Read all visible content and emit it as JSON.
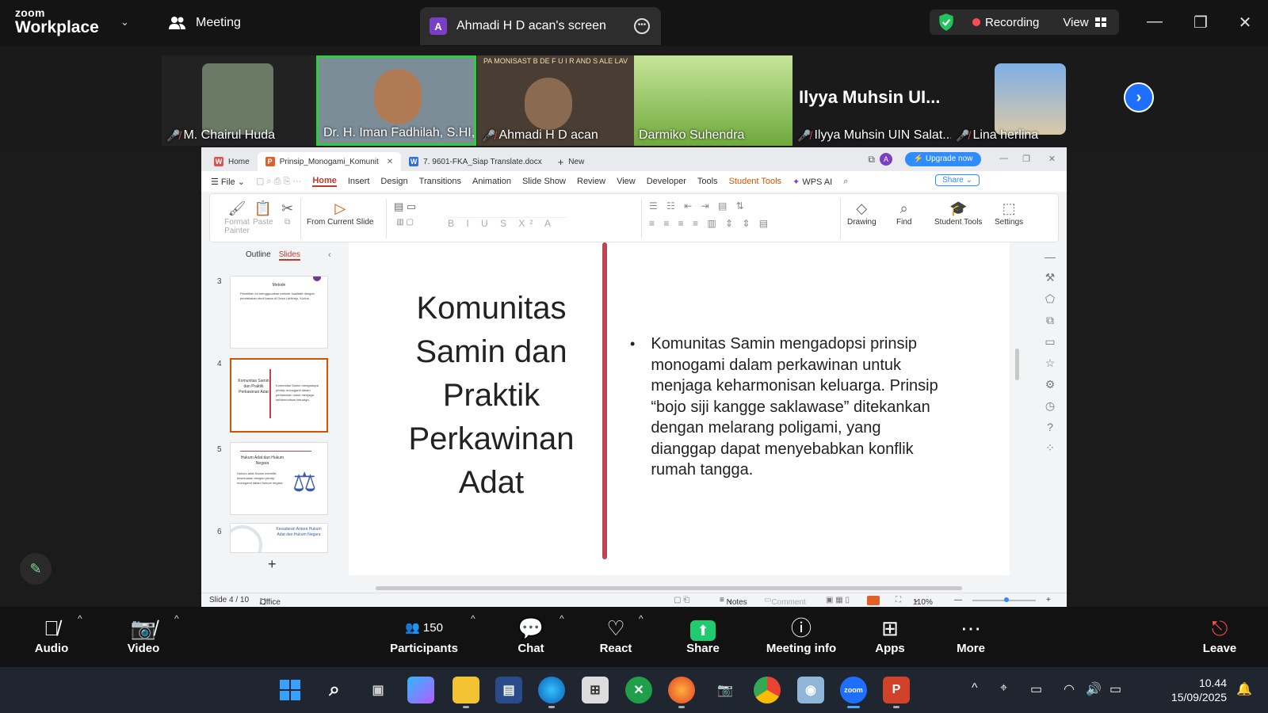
{
  "zoom": {
    "brand_top": "zoom",
    "brand_bottom": "Workplace",
    "meeting_tab": "Meeting",
    "screen_tab_initial": "A",
    "screen_tab_label": "Ahmadi H D acan's screen",
    "recording_label": "Recording",
    "view_label": "View"
  },
  "participants_strip": [
    {
      "name": "M. Chairul Huda",
      "muted": true,
      "bg": "#6b7a64"
    },
    {
      "name": "Dr. H. Iman Fadhilah, S.HI,...",
      "muted": false,
      "bg": "#7c8d98",
      "active": true
    },
    {
      "name": "Ahmadi H D acan",
      "muted": true,
      "bg": "#4a3d33",
      "overlay_text": "PA MONISAST B DE F U I R  AND S ALE LAV"
    },
    {
      "name": "Darmiko Suhendra",
      "muted": false,
      "bg": "#8fc75a"
    },
    {
      "name": "Ilyya Muhsin UIN Salat...",
      "muted": true,
      "bg": "#1e1e1e",
      "big_name": "Ilyya Muhsin UI..."
    },
    {
      "name": "Lina herlina",
      "muted": true,
      "bg": "#5d8fc2"
    }
  ],
  "wps": {
    "tabs": [
      {
        "label": "Home",
        "icon": "W",
        "color": "#d9534f"
      },
      {
        "label": "Prinsip_Monogami_Komunit",
        "icon": "P",
        "color": "#e0602a",
        "active": true
      },
      {
        "label": "7. 9601-FKA_Siap Translate.docx",
        "icon": "W",
        "color": "#2f6fd6"
      },
      {
        "label": "New",
        "icon": "+",
        "color": "#999"
      }
    ],
    "upgrade_label": "Upgrade now",
    "user_initial": "A",
    "menu": [
      "File",
      "Home",
      "Insert",
      "Design",
      "Transitions",
      "Animation",
      "Slide Show",
      "Review",
      "View",
      "Developer",
      "Tools",
      "Student Tools",
      "WPS AI"
    ],
    "share_label": "Share",
    "ribbon": {
      "format_painter": "Format Painter",
      "paste": "Paste",
      "from_current_slide": "From Current Slide",
      "drawing": "Drawing",
      "find": "Find",
      "student_tools": "Student Tools",
      "settings": "Settings"
    },
    "panel_tabs": [
      "Outline",
      "Slides"
    ],
    "thumbs": [
      {
        "num": "3",
        "title": "Metode",
        "text": "Penelitian ini menggunakan metode kualitatif dengan pendekatan studi kasus di Desa Larikrejo, Kudus."
      },
      {
        "num": "4",
        "title": "Komunitas Samin dan Praktik Perkawinan Adat",
        "text": "Komunitas Samin mengadopsi prinsip monogami dalam perkawinan untuk menjaga keharmonisan keluarga."
      },
      {
        "num": "5",
        "title": "Hukum Adat dan Hukum Negara",
        "text": "Hukum adat Samin memiliki kesesuaian dengan prinsip monogami dalam hukum negara."
      },
      {
        "num": "6",
        "title": "Kesadaran Antara Hukum Adat dan Hukum Negara",
        "text": ""
      }
    ],
    "slide": {
      "title": "Komunitas Samin dan Praktik Perkawinan Adat",
      "bullet": "Komunitas Samin mengadopsi prinsip monogami dalam perkawinan untuk menjaga keharmonisan keluarga. Prinsip “bojo siji kangge saklawase” ditekankan dengan melarang poligami, yang dianggap dapat menyebabkan konflik rumah tangga."
    },
    "status": {
      "slide_counter": "Slide 4 / 10",
      "theme": "Office Theme",
      "notes": "Notes",
      "comment": "Comment",
      "zoom": "110%"
    }
  },
  "controls": {
    "audio": "Audio",
    "video": "Video",
    "participants": "Participants",
    "participants_count": "150",
    "chat": "Chat",
    "react": "React",
    "share": "Share",
    "meeting_info": "Meeting info",
    "apps": "Apps",
    "more": "More",
    "leave": "Leave"
  },
  "taskbar": {
    "time": "10.44",
    "date": "15/09/2025"
  },
  "colors": {
    "zoom_blue": "#1f6fff",
    "share_green": "#1ecb6e",
    "recording_red": "#ff4d4f",
    "active_speaker": "#2ecc40",
    "slide_accent": "#c0444f"
  }
}
